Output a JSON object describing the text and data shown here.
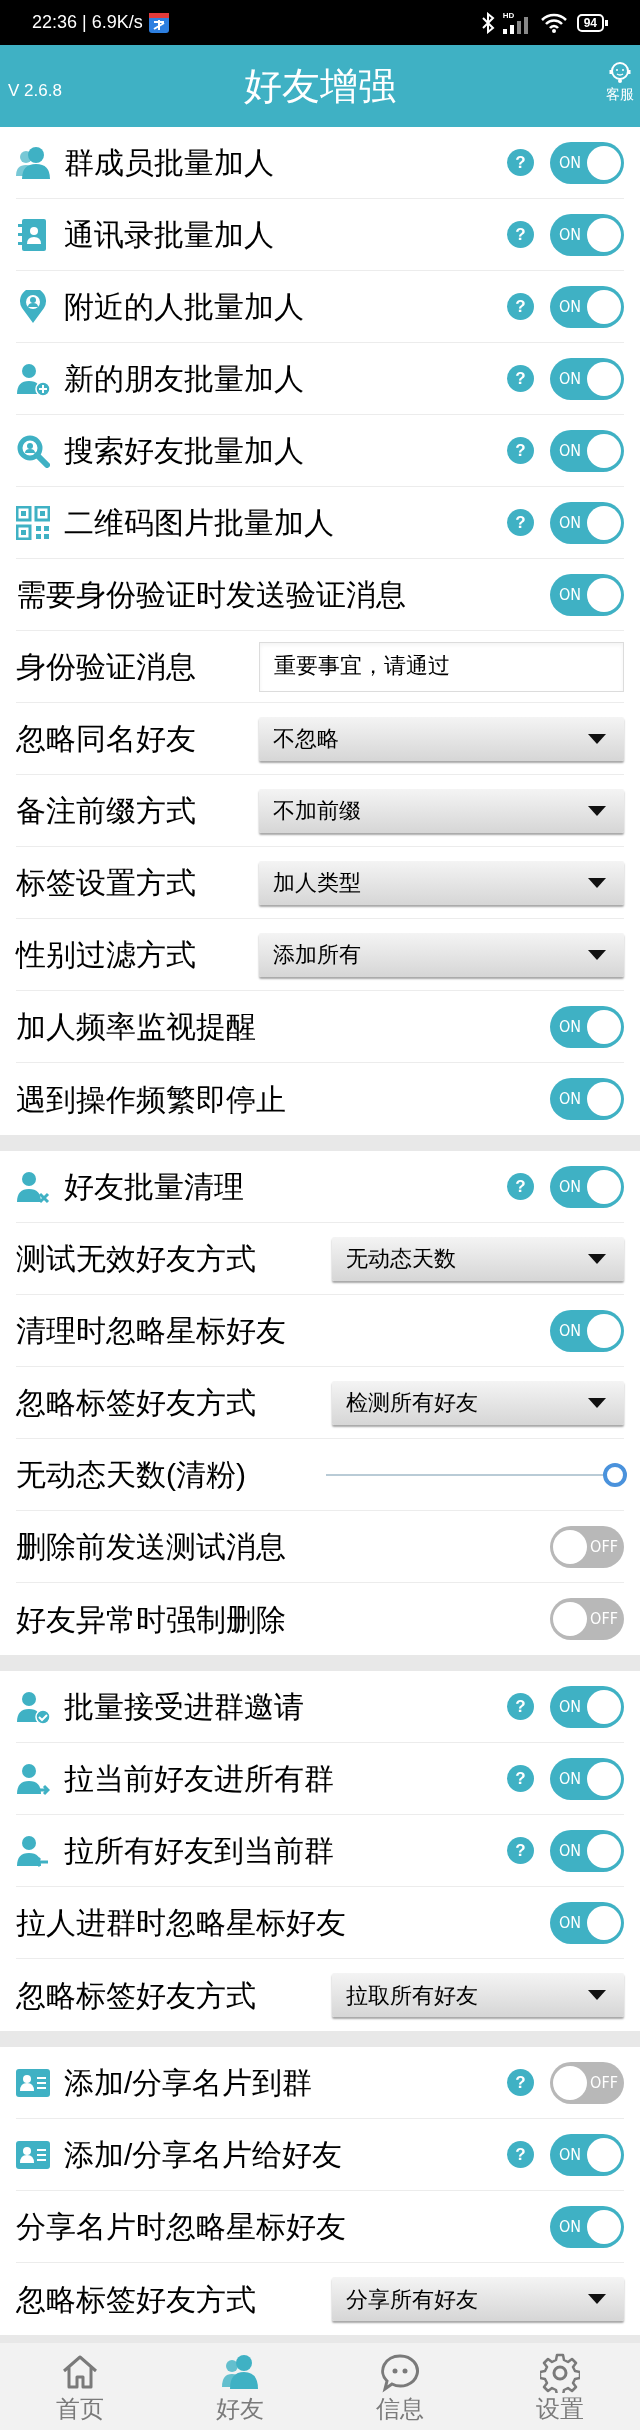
{
  "status_bar": {
    "time": "22:36 | 6.9K/s",
    "network": "HD",
    "battery": "94"
  },
  "header": {
    "version": "V 2.6.8",
    "title": "好友增强",
    "service_label": "客服"
  },
  "sections": [
    {
      "rows": [
        {
          "kind": "switch",
          "label": "群成员批量加人",
          "icon": true,
          "help": "?",
          "on": true,
          "switch_text": "ON"
        },
        {
          "kind": "switch",
          "label": "通讯录批量加人",
          "icon": true,
          "help": "?",
          "on": true,
          "switch_text": "ON"
        },
        {
          "kind": "switch",
          "label": "附近的人批量加人",
          "icon": true,
          "help": "?",
          "on": true,
          "switch_text": "ON"
        },
        {
          "kind": "switch",
          "label": "新的朋友批量加人",
          "icon": true,
          "help": "?",
          "on": true,
          "switch_text": "ON"
        },
        {
          "kind": "switch",
          "label": "搜索好友批量加人",
          "icon": true,
          "help": "?",
          "on": true,
          "switch_text": "ON"
        },
        {
          "kind": "switch",
          "label": "二维码图片批量加人",
          "icon": true,
          "help": "?",
          "on": true,
          "switch_text": "ON"
        },
        {
          "kind": "switch",
          "label": "需要身份验证时发送验证消息",
          "on": true,
          "switch_text": "ON"
        },
        {
          "kind": "input",
          "label": "身份验证消息",
          "value": "重要事宜，请通过"
        },
        {
          "kind": "select",
          "label": "忽略同名好友",
          "value": "不忽略"
        },
        {
          "kind": "select",
          "label": "备注前缀方式",
          "value": "不加前缀"
        },
        {
          "kind": "select",
          "label": "标签设置方式",
          "value": "加人类型"
        },
        {
          "kind": "select",
          "label": "性别过滤方式",
          "value": "添加所有"
        },
        {
          "kind": "switch",
          "label": "加人频率监视提醒",
          "on": true,
          "switch_text": "ON"
        },
        {
          "kind": "switch",
          "label": "遇到操作频繁即停止",
          "on": true,
          "switch_text": "ON"
        }
      ]
    },
    {
      "rows": [
        {
          "kind": "switch",
          "label": "好友批量清理",
          "icon": true,
          "help": "?",
          "on": true,
          "switch_text": "ON"
        },
        {
          "kind": "select",
          "label": "测试无效好友方式",
          "value": "无动态天数"
        },
        {
          "kind": "switch",
          "label": "清理时忽略星标好友",
          "on": true,
          "switch_text": "ON"
        },
        {
          "kind": "select",
          "label": "忽略标签好友方式",
          "value": "检测所有好友"
        },
        {
          "kind": "slider",
          "label": "无动态天数(清粉)",
          "level": 0.97
        },
        {
          "kind": "switch",
          "label": "删除前发送测试消息",
          "on": false,
          "switch_text": "OFF"
        },
        {
          "kind": "switch",
          "label": "好友异常时强制删除",
          "on": false,
          "switch_text": "OFF"
        }
      ]
    },
    {
      "rows": [
        {
          "kind": "switch",
          "label": "批量接受进群邀请",
          "icon": true,
          "help": "?",
          "on": true,
          "switch_text": "ON"
        },
        {
          "kind": "switch",
          "label": "拉当前好友进所有群",
          "icon": true,
          "help": "?",
          "on": true,
          "switch_text": "ON"
        },
        {
          "kind": "switch",
          "label": "拉所有好友到当前群",
          "icon": true,
          "help": "?",
          "on": true,
          "switch_text": "ON"
        },
        {
          "kind": "switch",
          "label": "拉人进群时忽略星标好友",
          "on": true,
          "switch_text": "ON"
        },
        {
          "kind": "select",
          "label": "忽略标签好友方式",
          "value": "拉取所有好友"
        }
      ]
    },
    {
      "rows": [
        {
          "kind": "switch",
          "label": "添加/分享名片到群",
          "icon": true,
          "help": "?",
          "on": false,
          "switch_text": "OFF"
        },
        {
          "kind": "switch",
          "label": "添加/分享名片给好友",
          "icon": true,
          "help": "?",
          "on": true,
          "switch_text": "ON"
        },
        {
          "kind": "switch",
          "label": "分享名片时忽略星标好友",
          "on": true,
          "switch_text": "ON"
        },
        {
          "kind": "select",
          "label": "忽略标签好友方式",
          "value": "分享所有好友"
        }
      ]
    }
  ],
  "nav": [
    {
      "label": "首页",
      "selected": false
    },
    {
      "label": "好友",
      "selected": true
    },
    {
      "label": "信息",
      "selected": false
    },
    {
      "label": "设置",
      "selected": false
    }
  ]
}
